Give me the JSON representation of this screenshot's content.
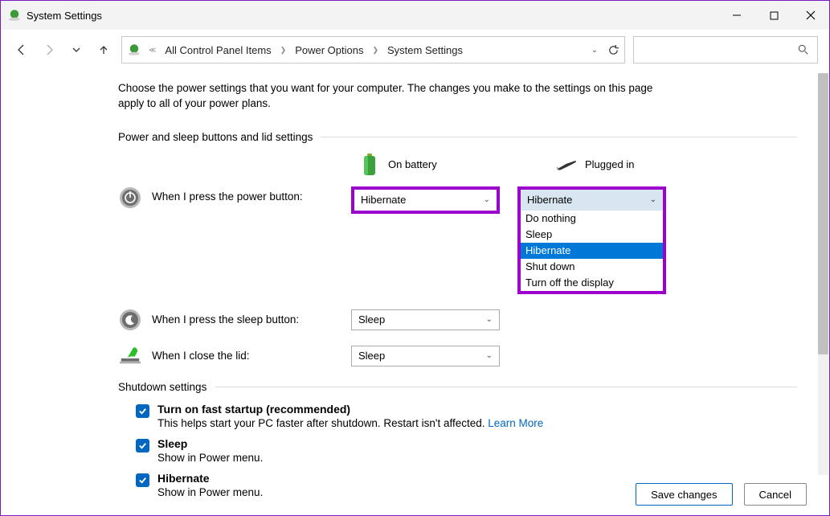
{
  "window": {
    "title": "System Settings"
  },
  "breadcrumb": {
    "item1": "All Control Panel Items",
    "item2": "Power Options",
    "item3": "System Settings"
  },
  "intro": "Choose the power settings that you want for your computer. The changes you make to the settings on this page apply to all of your power plans.",
  "section1_title": "Power and sleep buttons and lid settings",
  "columns": {
    "battery": "On battery",
    "plugged": "Plugged in"
  },
  "rows": {
    "power": {
      "label": "When I press the power button:",
      "battery_value": "Hibernate",
      "plugged_value": "Hibernate"
    },
    "sleep": {
      "label": "When I press the sleep button:",
      "battery_value": "Sleep"
    },
    "lid": {
      "label": "When I close the lid:",
      "battery_value": "Sleep"
    }
  },
  "dropdown_options": {
    "opt0": "Do nothing",
    "opt1": "Sleep",
    "opt2": "Hibernate",
    "opt3": "Shut down",
    "opt4": "Turn off the display"
  },
  "section2_title": "Shutdown settings",
  "shutdown": {
    "fast": {
      "title": "Turn on fast startup (recommended)",
      "desc": "This helps start your PC faster after shutdown. Restart isn't affected. ",
      "link": "Learn More"
    },
    "sleep": {
      "title": "Sleep",
      "desc": "Show in Power menu."
    },
    "hibernate": {
      "title": "Hibernate",
      "desc": "Show in Power menu."
    }
  },
  "buttons": {
    "save": "Save changes",
    "cancel": "Cancel"
  }
}
